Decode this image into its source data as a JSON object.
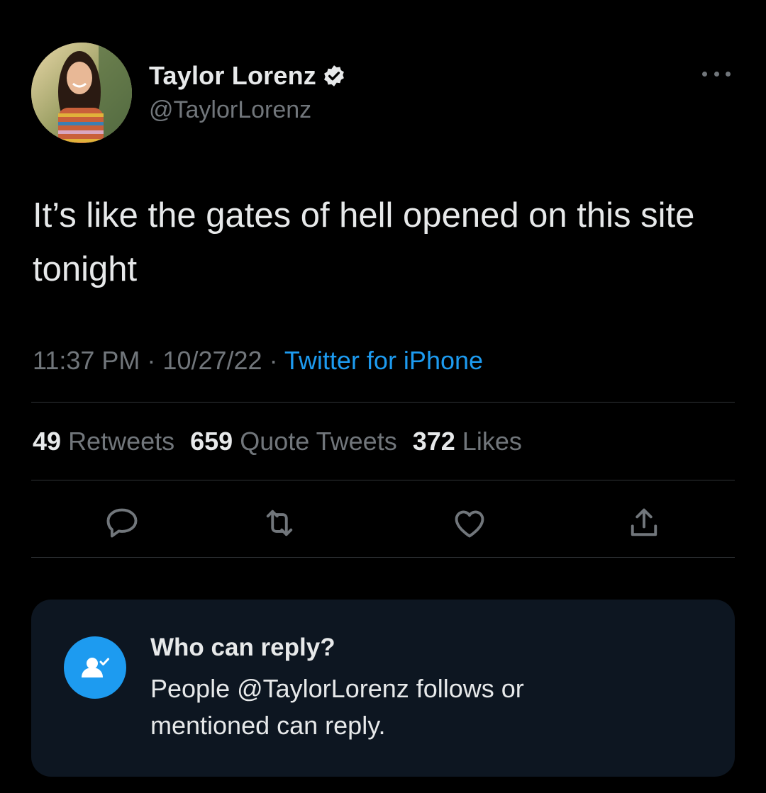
{
  "author": {
    "display_name": "Taylor Lorenz",
    "handle": "@TaylorLorenz"
  },
  "tweet": {
    "text": "It’s like the gates of hell opened on this site tonight",
    "time": "11:37 PM",
    "separator": " · ",
    "date": "10/27/22",
    "source": "Twitter for iPhone"
  },
  "stats": {
    "retweets_count": "49",
    "retweets_label": "Retweets",
    "quote_tweets_count": "659",
    "quote_tweets_label": "Quote Tweets",
    "likes_count": "372",
    "likes_label": "Likes"
  },
  "reply_settings": {
    "title": "Who can reply?",
    "description": "People @TaylorLorenz follows or mentioned can reply."
  },
  "colors": {
    "background": "#000000",
    "text": "#e7e9ea",
    "muted": "#71767b",
    "accent": "#1d9bf0",
    "card": "#0d1621"
  },
  "icons": [
    "verified-badge-icon",
    "more-icon",
    "reply-icon",
    "retweet-icon",
    "like-icon",
    "share-icon",
    "person-check-icon"
  ]
}
